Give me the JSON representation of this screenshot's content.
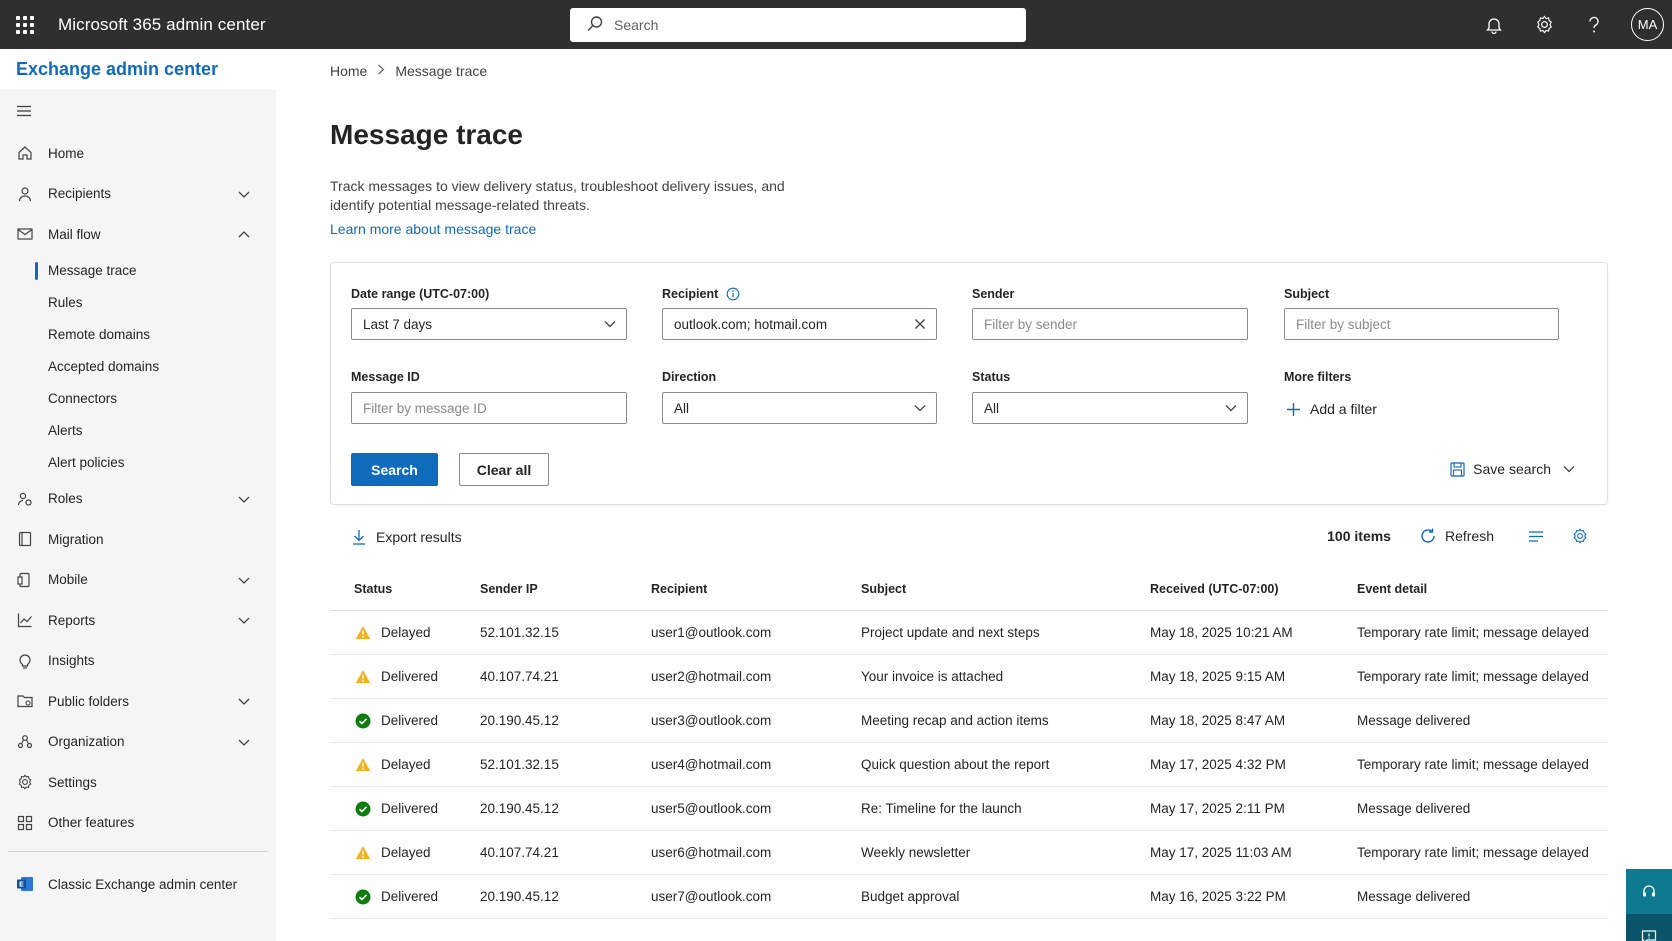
{
  "topbar": {
    "title": "Microsoft 365 admin center",
    "search_placeholder": "Search",
    "avatar_initials": "MA",
    "icons": [
      "waffle-icon",
      "bell-icon",
      "gear-icon",
      "help-icon"
    ]
  },
  "sidebar": {
    "title": "Exchange admin center",
    "items": [
      {
        "label": "Home",
        "icon": "home-icon",
        "expandable": false
      },
      {
        "label": "Recipients",
        "icon": "person-icon",
        "expandable": true
      },
      {
        "label": "Mail flow",
        "icon": "mail-icon",
        "expandable": true,
        "expanded": true
      },
      {
        "label": "Roles",
        "icon": "roles-icon",
        "expandable": true
      },
      {
        "label": "Migration",
        "icon": "migration-icon",
        "expandable": false
      },
      {
        "label": "Mobile",
        "icon": "mobile-icon",
        "expandable": true
      },
      {
        "label": "Reports",
        "icon": "chart-icon",
        "expandable": true
      },
      {
        "label": "Insights",
        "icon": "lightbulb-icon",
        "expandable": false
      },
      {
        "label": "Public folders",
        "icon": "folder-icon",
        "expandable": true
      },
      {
        "label": "Organization",
        "icon": "organization-icon",
        "expandable": true
      },
      {
        "label": "Settings",
        "icon": "gear-icon",
        "expandable": false
      },
      {
        "label": "Other features",
        "icon": "grid-icon",
        "expandable": false
      }
    ],
    "mail_flow_sub": [
      "Message trace",
      "Rules",
      "Remote domains",
      "Accepted domains",
      "Connectors",
      "Alerts",
      "Alert policies"
    ],
    "classic_link": "Classic Exchange admin center"
  },
  "breadcrumb": {
    "home": "Home",
    "current": "Message trace"
  },
  "page": {
    "title": "Message trace",
    "description": "Track messages to view delivery status, troubleshoot delivery issues, and identify potential message-related threats.",
    "learn_more": "Learn more about message trace"
  },
  "filters": {
    "date_range": {
      "label": "Date range (UTC-07:00)",
      "value": "Last 7 days"
    },
    "recipient": {
      "label": "Recipient",
      "value": "outlook.com; hotmail.com"
    },
    "sender": {
      "label": "Sender",
      "placeholder": "Filter by sender"
    },
    "subject": {
      "label": "Subject",
      "placeholder": "Filter by subject"
    },
    "message_id": {
      "label": "Message ID",
      "placeholder": "Filter by message ID"
    },
    "direction": {
      "label": "Direction",
      "value": "All"
    },
    "status": {
      "label": "Status",
      "value": "All"
    },
    "more_filters": {
      "label": "More filters",
      "add_label": "Add a filter"
    },
    "search_button": "Search",
    "clear_button": "Clear all",
    "save_search": "Save search"
  },
  "toolbar": {
    "export": "Export results",
    "count": "100 items",
    "refresh": "Refresh"
  },
  "table": {
    "headers": [
      "Status",
      "Sender IP",
      "Recipient",
      "Subject",
      "Received (UTC-07:00)",
      "Event detail"
    ],
    "rows": [
      {
        "status": "Delayed",
        "status_kind": "warning",
        "ip": "52.101.32.15",
        "recipient": "user1@outlook.com",
        "subject": "Project update and next steps",
        "received": "May 18, 2025 10:21 AM",
        "event": "Temporary rate limit; message delayed"
      },
      {
        "status": "Delivered",
        "status_kind": "warning",
        "ip": "40.107.74.21",
        "recipient": "user2@hotmail.com",
        "subject": "Your invoice is attached",
        "received": "May 18, 2025 9:15 AM",
        "event": "Temporary rate limit; message delayed"
      },
      {
        "status": "Delivered",
        "status_kind": "success",
        "ip": "20.190.45.12",
        "recipient": "user3@outlook.com",
        "subject": "Meeting recap and action items",
        "received": "May 18, 2025 8:47 AM",
        "event": "Message delivered"
      },
      {
        "status": "Delayed",
        "status_kind": "warning",
        "ip": "52.101.32.15",
        "recipient": "user4@hotmail.com",
        "subject": "Quick question about the report",
        "received": "May 17, 2025 4:32 PM",
        "event": "Temporary rate limit; message delayed"
      },
      {
        "status": "Delivered",
        "status_kind": "success",
        "ip": "20.190.45.12",
        "recipient": "user5@outlook.com",
        "subject": "Re: Timeline for the launch",
        "received": "May 17, 2025 2:11 PM",
        "event": "Message delivered"
      },
      {
        "status": "Delayed",
        "status_kind": "warning",
        "ip": "40.107.74.21",
        "recipient": "user6@hotmail.com",
        "subject": "Weekly newsletter",
        "received": "May 17, 2025 11:03 AM",
        "event": "Temporary rate limit; message delayed"
      },
      {
        "status": "Delivered",
        "status_kind": "success",
        "ip": "20.190.45.12",
        "recipient": "user7@outlook.com",
        "subject": "Budget approval",
        "received": "May 16, 2025 3:22 PM",
        "event": "Message delivered"
      }
    ]
  },
  "colors": {
    "accent": "#0f6cbd",
    "topbar": "#2f2f2f",
    "warning": "#f2b21a",
    "success": "#107c10",
    "floating": "#0b556a"
  }
}
